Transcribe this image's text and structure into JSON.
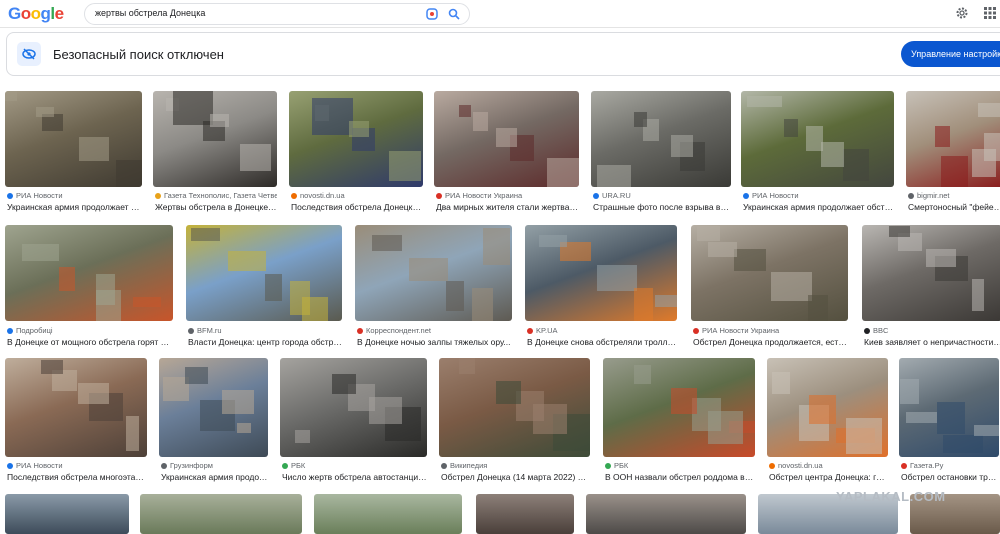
{
  "header": {
    "logo_letters": [
      {
        "ch": "G",
        "color": "#4285f4"
      },
      {
        "ch": "o",
        "color": "#ea4335"
      },
      {
        "ch": "o",
        "color": "#fbbc05"
      },
      {
        "ch": "g",
        "color": "#4285f4"
      },
      {
        "ch": "l",
        "color": "#34a853"
      },
      {
        "ch": "e",
        "color": "#ea4335"
      }
    ],
    "query": "жертвы обстрела Донецка",
    "icons": [
      "lens-icon",
      "search-icon",
      "gear-icon",
      "apps-icon"
    ]
  },
  "safe_search": {
    "text": "Безопасный поиск отключен",
    "button": "Управление настройками"
  },
  "results": [
    {
      "source": "РИА Новости",
      "title": "Украинская армия продолжает о...",
      "fav": "#1a73e8",
      "colors": [
        "#6d6450",
        "#a39a86",
        "#3f3a31"
      ]
    },
    {
      "source": "Газета Технополис, Газета Четве...",
      "title": "Жертвы обстрела в Донецке ...",
      "fav": "#e8a21a",
      "colors": [
        "#8c8a86",
        "#b8b4ae",
        "#2e2b28"
      ]
    },
    {
      "source": "novosti.dn.ua",
      "title": "Последствия обстрела Донецка ...",
      "fav": "#ef6c00",
      "colors": [
        "#5f6b3f",
        "#98a173",
        "#2f3a6b"
      ]
    },
    {
      "source": "РИА Новости Украина",
      "title": "Два мирных жителя стали жертвам...",
      "fav": "#d93025",
      "colors": [
        "#746963",
        "#b9aaa0",
        "#5d2a2a"
      ]
    },
    {
      "source": "URA.RU",
      "title": "Страшные фото после взрыва в Д...",
      "fav": "#1a73e8",
      "colors": [
        "#6b6b66",
        "#a9a9a2",
        "#3a3a36"
      ]
    },
    {
      "source": "РИА Новости",
      "title": "Украинская армия продолжает обстр...",
      "fav": "#1a73e8",
      "colors": [
        "#5d6b3a",
        "#b3b7a8",
        "#43463e"
      ]
    },
    {
      "source": "bigmir.net",
      "title": "Смертоносный \"фейерве...",
      "fav": "#5f6368",
      "colors": [
        "#a18f7b",
        "#c7c1b8",
        "#8a1c1c"
      ]
    },
    {
      "source": "Подробиці",
      "title": "В Донецке от мощного обстрела горят до...",
      "fav": "#1a73e8",
      "colors": [
        "#6b6f58",
        "#9fa48f",
        "#c8552a"
      ]
    },
    {
      "source": "BFM.ru",
      "title": "Власти Донецка: центр города обстре...",
      "fav": "#5f6368",
      "colors": [
        "#7aa0c9",
        "#c4b23a",
        "#5a5a4f"
      ]
    },
    {
      "source": "Корреспондент.net",
      "title": "В Донецке ночью залпы тяжелых ору...",
      "fav": "#d93025",
      "colors": [
        "#8fa5b8",
        "#9a8d79",
        "#5e5a52"
      ]
    },
    {
      "source": "KP.UA",
      "title": "В Донецке снова обстреляли троллей...",
      "fav": "#d93025",
      "colors": [
        "#4d5a66",
        "#93a0a6",
        "#e07a2a"
      ]
    },
    {
      "source": "РИА Новости Украина",
      "title": "Обстрел Донецка продолжается, есть ...",
      "fav": "#d93025",
      "colors": [
        "#7d7365",
        "#b6afa4",
        "#54503f"
      ]
    },
    {
      "source": "BBC",
      "title": "Киев заявляет о непричастности к о...",
      "fav": "#202124",
      "colors": [
        "#6e6a66",
        "#b9b6b2",
        "#3b3835"
      ]
    },
    {
      "source": "РИА Новости",
      "title": "Последствия обстрела многоэтаж...",
      "fav": "#1a73e8",
      "colors": [
        "#8a6a55",
        "#bfae9c",
        "#4d4038"
      ]
    },
    {
      "source": "Грузинформ",
      "title": "Украинская армия продол...",
      "fav": "#5f6368",
      "colors": [
        "#6b7f99",
        "#b7a796",
        "#3e4a56"
      ]
    },
    {
      "source": "РБК",
      "title": "Число жертв обстрела автостанции ...",
      "fav": "#34a853",
      "colors": [
        "#6c6c6a",
        "#a5a39f",
        "#2a2a28"
      ]
    },
    {
      "source": "Википедия",
      "title": "Обстрел Донецка (14 марта 2022) — В...",
      "fav": "#5f6368",
      "colors": [
        "#7a5a45",
        "#9b7f6d",
        "#3d4b38"
      ]
    },
    {
      "source": "РБК",
      "title": "В ООН назвали обстрел роддома в Д...",
      "fav": "#34a853",
      "colors": [
        "#5e6c48",
        "#989c8d",
        "#c84a2a"
      ]
    },
    {
      "source": "novosti.dn.ua",
      "title": "Обстрел центра Донецка: гор...",
      "fav": "#ef6c00",
      "colors": [
        "#9c8f7e",
        "#c8c1b6",
        "#e0702a"
      ]
    },
    {
      "source": "Газета.Ру",
      "title": "Обстрел остановки тролле...",
      "fav": "#d93025",
      "colors": [
        "#5d6a74",
        "#a3abb0",
        "#2f4a6a"
      ]
    }
  ],
  "bottom_row": [
    {
      "colors": [
        "#3d4b5a",
        "#8a9aa8"
      ]
    },
    {
      "colors": [
        "#6a7a5a",
        "#a8b09a"
      ]
    },
    {
      "colors": [
        "#6a7f5a",
        "#a9b7a0"
      ]
    },
    {
      "colors": [
        "#4a3f3a",
        "#8d8079"
      ]
    },
    {
      "colors": [
        "#4d4a48",
        "#9a918a"
      ]
    },
    {
      "colors": [
        "#7a8a9a",
        "#c0c8cf"
      ]
    },
    {
      "colors": [
        "#6a5a4a",
        "#a49484"
      ]
    }
  ],
  "watermark": "YAPLAKAL.COM"
}
